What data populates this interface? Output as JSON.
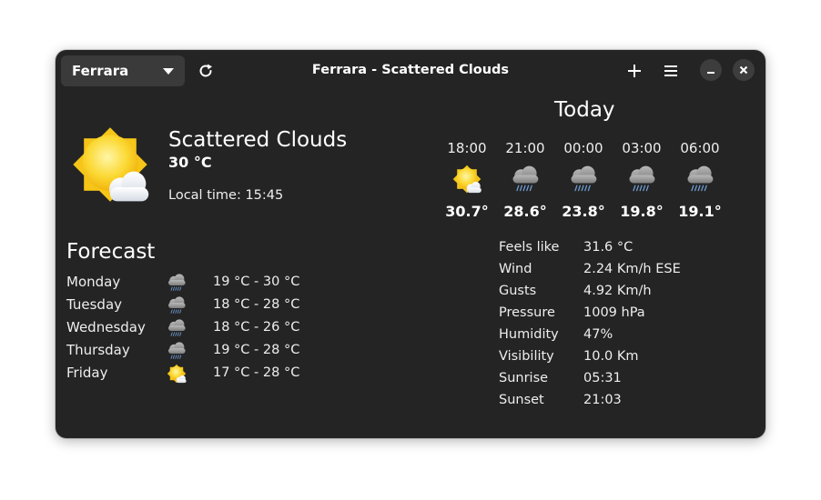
{
  "header": {
    "location": "Ferrara",
    "title": "Ferrara - Scattered Clouds",
    "icons": [
      "refresh-icon",
      "plus-icon",
      "hamburger-menu-icon",
      "minimize-icon",
      "close-icon"
    ]
  },
  "current": {
    "condition": "Scattered Clouds",
    "temperature": "30 °C",
    "local_time": "Local time: 15:45",
    "icon": "sun-cloud-icon"
  },
  "today": {
    "title": "Today",
    "hours": [
      {
        "time": "18:00",
        "temp": "30.7°",
        "icon": "sun-cloud"
      },
      {
        "time": "21:00",
        "temp": "28.6°",
        "icon": "rain"
      },
      {
        "time": "00:00",
        "temp": "23.8°",
        "icon": "rain"
      },
      {
        "time": "03:00",
        "temp": "19.8°",
        "icon": "rain"
      },
      {
        "time": "06:00",
        "temp": "19.1°",
        "icon": "rain"
      }
    ]
  },
  "forecast": {
    "title": "Forecast",
    "days": [
      {
        "day": "Monday",
        "range": "19 °C - 30 °C",
        "icon": "rain"
      },
      {
        "day": "Tuesday",
        "range": "18 °C - 28 °C",
        "icon": "rain"
      },
      {
        "day": "Wednesday",
        "range": "18 °C - 26 °C",
        "icon": "rain"
      },
      {
        "day": "Thursday",
        "range": "19 °C - 28 °C",
        "icon": "rain"
      },
      {
        "day": "Friday",
        "range": "17 °C - 28 °C",
        "icon": "sun-cloud"
      }
    ]
  },
  "details": [
    {
      "label": "Feels like",
      "value": "31.6 °C"
    },
    {
      "label": "Wind",
      "value": "2.24 Km/h ESE"
    },
    {
      "label": "Gusts",
      "value": "4.92 Km/h"
    },
    {
      "label": "Pressure",
      "value": "1009 hPa"
    },
    {
      "label": "Humidity",
      "value": "47%"
    },
    {
      "label": "Visibility",
      "value": "10.0 Km"
    },
    {
      "label": "Sunrise",
      "value": "05:31"
    },
    {
      "label": "Sunset",
      "value": "21:03"
    }
  ]
}
